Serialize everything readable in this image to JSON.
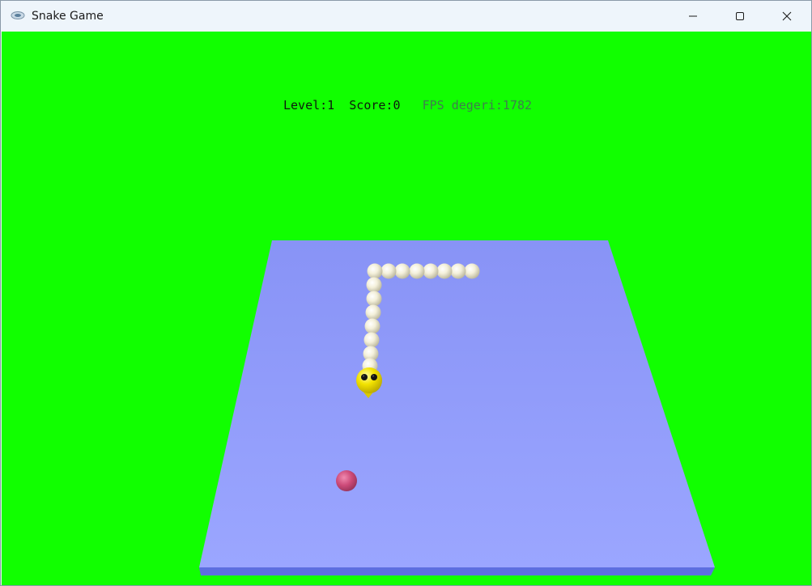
{
  "window": {
    "title": "Snake Game",
    "app_icon": "game-controller-icon",
    "controls": {
      "minimize_icon": "minimize-icon",
      "maximize_icon": "maximize-icon",
      "close_icon": "close-icon"
    }
  },
  "hud": {
    "level_text": "Level:1",
    "score_text": "Score:0",
    "fps_text": "FPS degeri:1782"
  },
  "game": {
    "level": 1,
    "score": 0,
    "fps": 1782,
    "snake_body_segments": 14,
    "colors": {
      "background": "#11ff00",
      "board": "#8c97f8",
      "board_edge": "#5d6fe0",
      "snake_body": "#f3f0dc",
      "snake_head": "#f2e200",
      "food": "#d5517f"
    }
  }
}
